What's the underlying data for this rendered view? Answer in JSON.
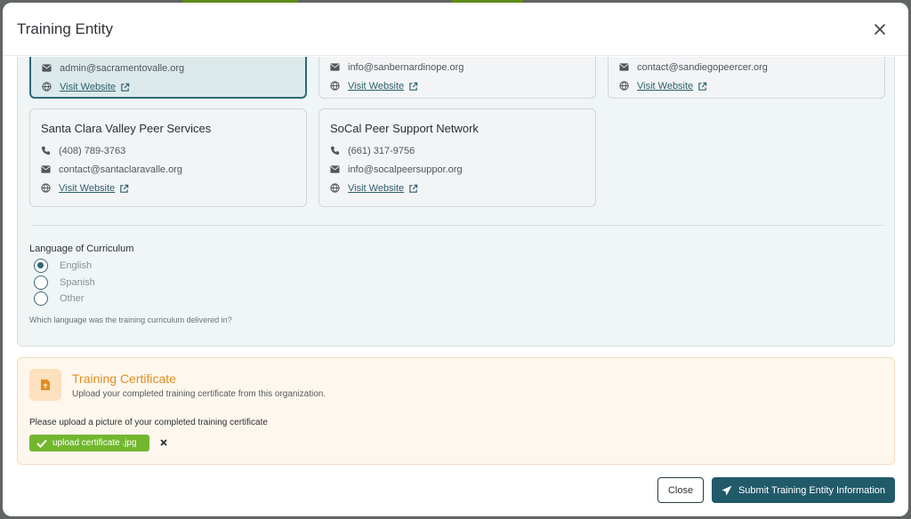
{
  "modal": {
    "title": "Training Entity"
  },
  "entities": [
    {
      "title": "",
      "email": "admin@sacramentovalle.org",
      "website_label": "Visit Website",
      "selected": true
    },
    {
      "title": "",
      "email": "info@sanbernardinope.org",
      "website_label": "Visit Website",
      "selected": false
    },
    {
      "title": "",
      "email": "contact@sandiegopeercer.org",
      "website_label": "Visit Website",
      "selected": false
    },
    {
      "title": "Santa Clara Valley Peer Services",
      "phone": "(408) 789-3763",
      "email": "contact@santaclaravalle.org",
      "website_label": "Visit Website",
      "selected": false
    },
    {
      "title": "SoCal Peer Support Network",
      "phone": "(661) 317-9756",
      "email": "info@socalpeersuppor.org",
      "website_label": "Visit Website",
      "selected": false
    }
  ],
  "language": {
    "label": "Language of Curriculum",
    "options": [
      "English",
      "Spanish",
      "Other"
    ],
    "selected": "English",
    "help": "Which language was the training curriculum delivered in?"
  },
  "certificate": {
    "title": "Training Certificate",
    "subtitle": "Upload your completed training certificate from this organization.",
    "prompt": "Please upload a picture of your completed training certificate",
    "file_name": "upload certificate .jpg"
  },
  "footer": {
    "close_label": "Close",
    "submit_label": "Submit Training Entity Information"
  },
  "colors": {
    "accent": "#215a69",
    "warning": "#e08e22",
    "success": "#73b72f"
  }
}
